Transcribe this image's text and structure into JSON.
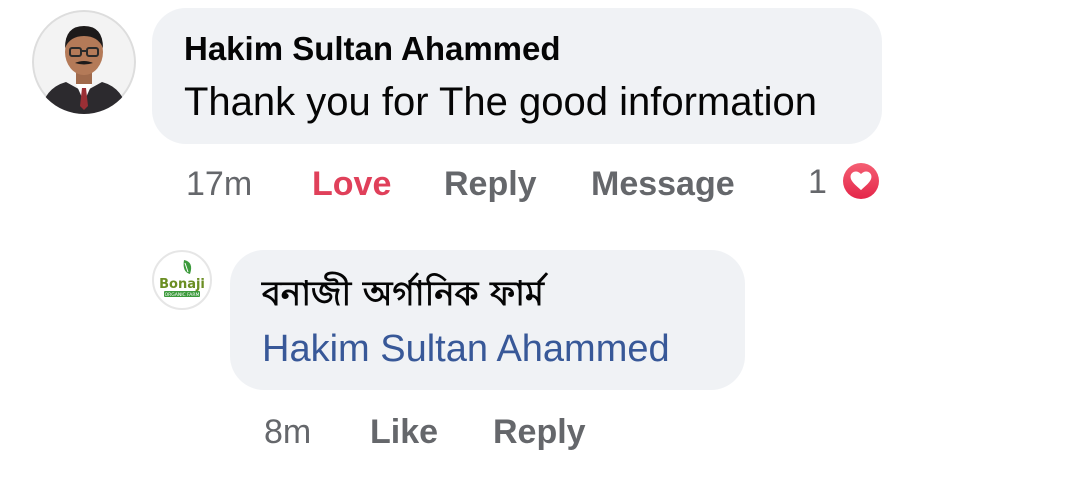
{
  "comment": {
    "author": "Hakim Sultan Ahammed",
    "text": "Thank you for The good information",
    "actions": {
      "time": "17m",
      "love": "Love",
      "reply": "Reply",
      "message": "Message"
    },
    "reactions": {
      "count": "1",
      "type": "heart-icon"
    }
  },
  "reply": {
    "author": "বনাজী অর্গানিক ফার্ম",
    "mention": "Hakim Sultan Ahammed",
    "actions": {
      "time": "8m",
      "like": "Like",
      "reply": "Reply"
    }
  },
  "colors": {
    "bubble": "#f0f2f5",
    "love": "#e0405a",
    "mention": "#385898",
    "meta": "#65676b"
  }
}
